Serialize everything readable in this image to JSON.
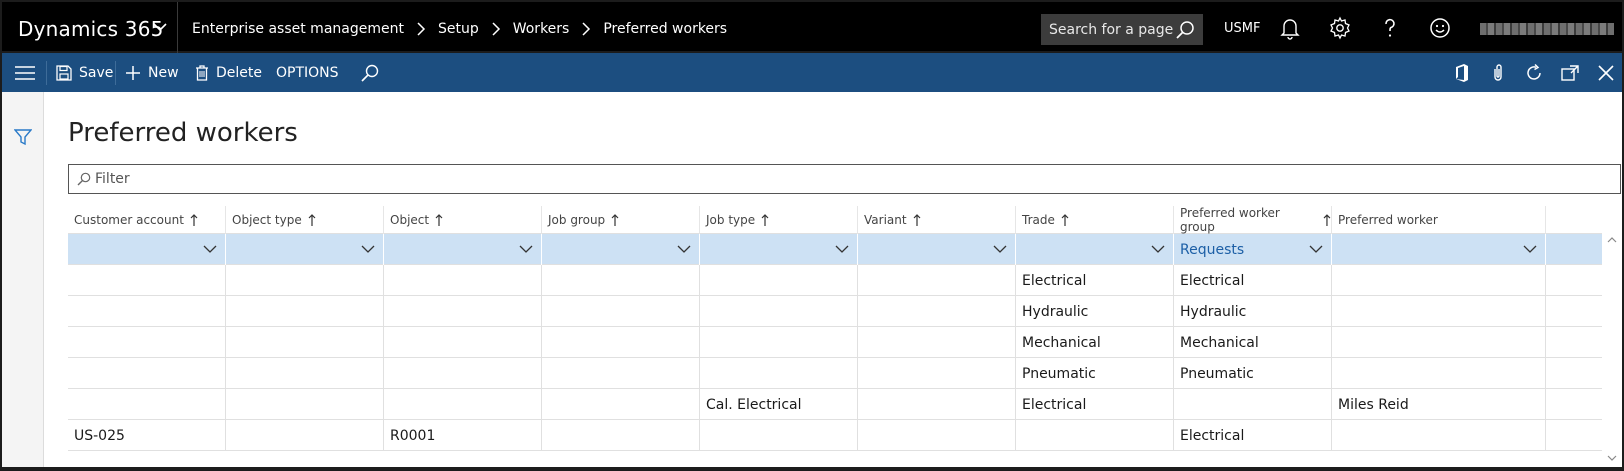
{
  "topbar": {
    "app_title": "Dynamics 365",
    "breadcrumbs": [
      "Enterprise asset management",
      "Setup",
      "Workers",
      "Preferred workers"
    ],
    "search_placeholder": "Search for a page",
    "company": "USMF",
    "icons": [
      "bell-icon",
      "gear-icon",
      "help-icon",
      "smiley-icon"
    ],
    "background": "#000000"
  },
  "actionbar": {
    "save_label": "Save",
    "new_label": "New",
    "delete_label": "Delete",
    "options_label": "OPTIONS",
    "background": "#1c4e80"
  },
  "page": {
    "title": "Preferred workers",
    "filter_placeholder": "Filter"
  },
  "grid": {
    "columns": [
      {
        "label": "Customer account",
        "sort": "ascending"
      },
      {
        "label": "Object type",
        "sort": "ascending"
      },
      {
        "label": "Object",
        "sort": "ascending"
      },
      {
        "label": "Job group",
        "sort": "ascending"
      },
      {
        "label": "Job type",
        "sort": "ascending"
      },
      {
        "label": "Variant",
        "sort": "ascending"
      },
      {
        "label": "Trade",
        "sort": "ascending"
      },
      {
        "label": "Preferred worker group",
        "sort": "ascending"
      },
      {
        "label": "Preferred worker",
        "sort": ""
      }
    ],
    "rows": [
      [
        "",
        "",
        "",
        "",
        "",
        "",
        "",
        "Requests",
        ""
      ],
      [
        "",
        "",
        "",
        "",
        "",
        "",
        "Electrical",
        "Electrical",
        ""
      ],
      [
        "",
        "",
        "",
        "",
        "",
        "",
        "Hydraulic",
        "Hydraulic",
        ""
      ],
      [
        "",
        "",
        "",
        "",
        "",
        "",
        "Mechanical",
        "Mechanical",
        ""
      ],
      [
        "",
        "",
        "",
        "",
        "",
        "",
        "Pneumatic",
        "Pneumatic",
        ""
      ],
      [
        "",
        "",
        "",
        "",
        "Cal. Electrical",
        "",
        "Electrical",
        "",
        "Miles Reid"
      ],
      [
        "US-025",
        "",
        "R0001",
        "",
        "",
        "",
        "",
        "Electrical",
        ""
      ]
    ],
    "selected_row": 0,
    "selected_color": "#cde1f4"
  }
}
